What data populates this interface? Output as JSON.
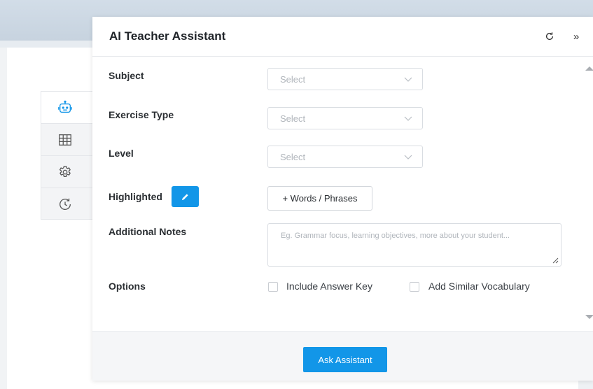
{
  "panel": {
    "title": "AI Teacher Assistant",
    "header_icons": [
      "history-refresh-icon",
      "collapse-double-chevron-icon"
    ],
    "collapse_glyph": "»"
  },
  "side_tabs": [
    {
      "icon": "robot-icon",
      "active": true
    },
    {
      "icon": "table-grid-icon",
      "active": false
    },
    {
      "icon": "settings-gear-icon",
      "active": false
    },
    {
      "icon": "history-clock-icon",
      "active": false
    }
  ],
  "form": {
    "subject": {
      "label": "Subject",
      "placeholder": "Select"
    },
    "exercise_type": {
      "label": "Exercise Type",
      "placeholder": "Select"
    },
    "level": {
      "label": "Level",
      "placeholder": "Select"
    },
    "highlighted": {
      "label": "Highlighted",
      "button_label": "+ Words / Phrases",
      "icon": "pencil-icon"
    },
    "additional_notes": {
      "label": "Additional Notes",
      "placeholder": "Eg. Grammar focus, learning objectives, more about your student..."
    },
    "options": {
      "label": "Options",
      "checkboxes": [
        {
          "label": "Include Answer Key",
          "checked": false
        },
        {
          "label": "Add Similar Vocabulary",
          "checked": false
        }
      ]
    }
  },
  "footer": {
    "ask_label": "Ask Assistant"
  },
  "colors": {
    "accent": "#1296e8",
    "title": "#1f2328",
    "placeholder": "#b0b5bb",
    "icon": "#1296e8"
  }
}
